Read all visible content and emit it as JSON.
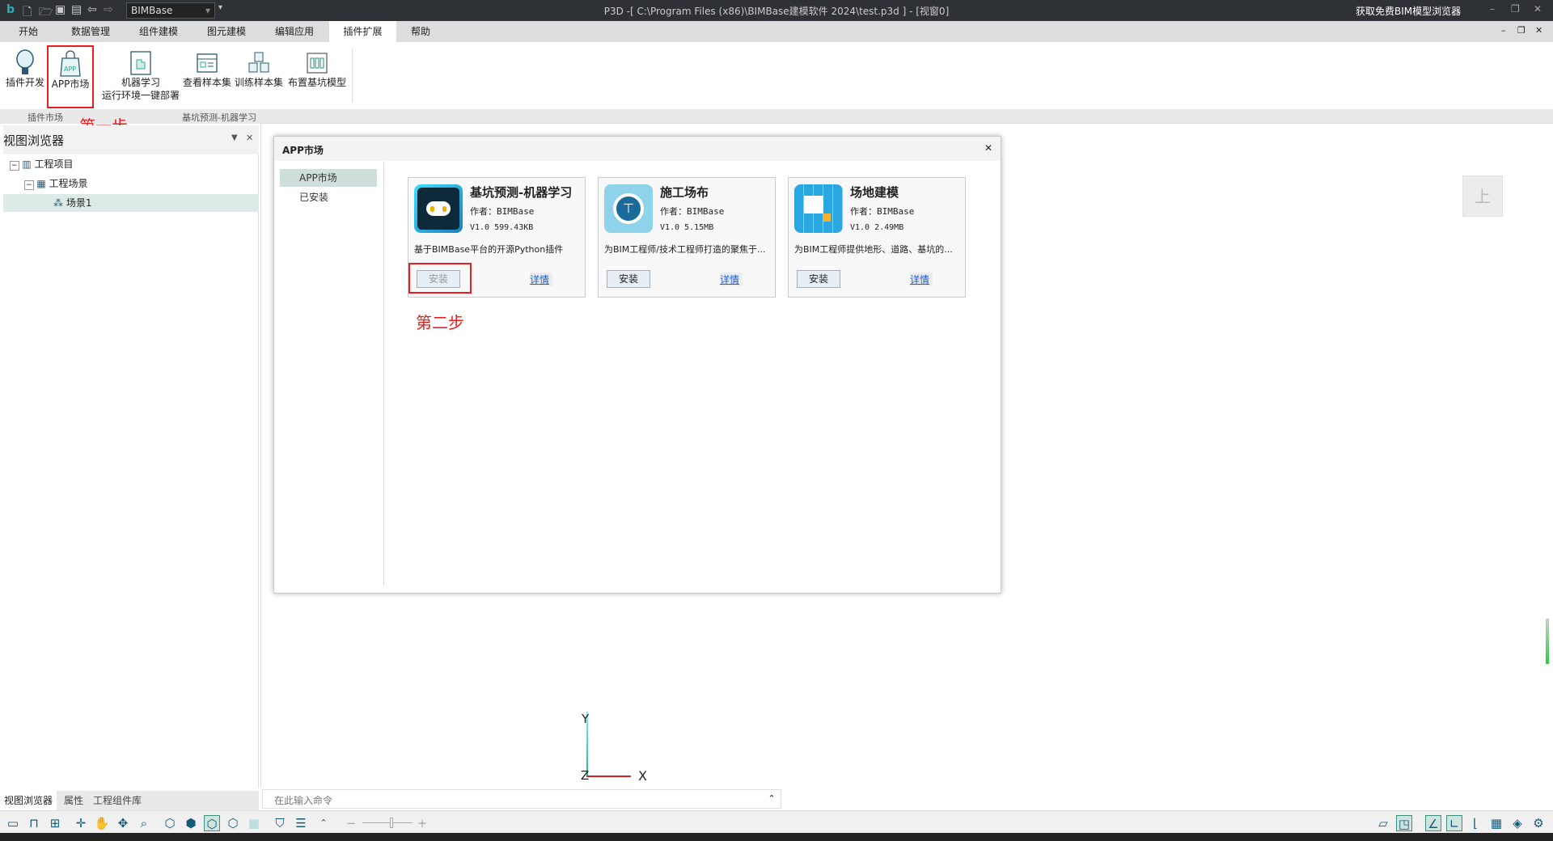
{
  "titlebar": {
    "doc_select": "BIMBase",
    "title": "P3D -[ C:\\Program Files (x86)\\BIMBase建模软件 2024\\test.p3d ] - [视窗0]",
    "get_viewer": "获取免费BIM模型浏览器"
  },
  "menu": {
    "tabs": [
      "开始",
      "数据管理",
      "组件建模",
      "图元建模",
      "编辑应用",
      "插件扩展",
      "帮助"
    ],
    "active": "插件扩展"
  },
  "ribbon": {
    "buttons": [
      "插件开发",
      "APP市场",
      "机器学习",
      "运行环境一键部署",
      "查看样本集",
      "训练样本集",
      "布置基坑模型"
    ],
    "groups": [
      "插件市场",
      "基坑预测-机器学习"
    ]
  },
  "annotations": {
    "step1": "第一步",
    "step2": "第二步"
  },
  "left_panel": {
    "title": "视图浏览器",
    "tree": [
      "工程项目",
      "工程场景",
      "场景1"
    ],
    "tabs": [
      "视图浏览器",
      "属性",
      "工程组件库"
    ]
  },
  "command": {
    "placeholder": "在此输入命令"
  },
  "dialog": {
    "title": "APP市场",
    "nav": [
      "APP市场",
      "已安装"
    ],
    "apps": [
      {
        "name": "基坑预测-机器学习",
        "author": "作者：BIMBase",
        "version": "V1.0  599.43KB",
        "desc": "基于BIMBase平台的开源Python插件",
        "install": "安装",
        "details": "详情"
      },
      {
        "name": "施工场布",
        "author": "作者：BIMBase",
        "version": "V1.0  5.15MB",
        "desc": "为BIM工程师/技术工程师打造的聚焦于...",
        "install": "安装",
        "details": "详情"
      },
      {
        "name": "场地建模",
        "author": "作者：BIMBase",
        "version": "V1.0  2.49MB",
        "desc": "为BIM工程师提供地形、道路、基坑的...",
        "install": "安装",
        "details": "详情"
      }
    ]
  },
  "viewport": {
    "cube_face": "上",
    "axis": {
      "x": "X",
      "y": "Y",
      "z": "Z"
    }
  }
}
